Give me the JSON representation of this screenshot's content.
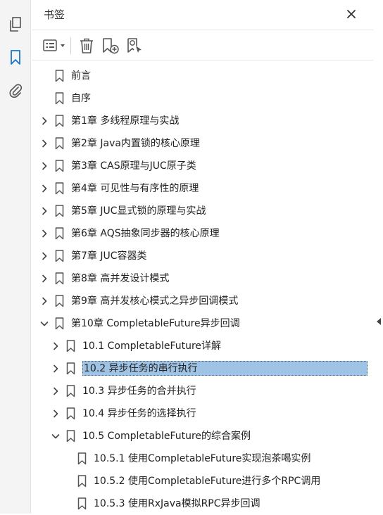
{
  "panel": {
    "title": "书签"
  },
  "rail": [
    {
      "name": "pages-icon"
    },
    {
      "name": "bookmark-icon",
      "active": true
    },
    {
      "name": "attachment-icon"
    }
  ],
  "toolbar": [
    {
      "name": "options-menu-icon"
    },
    {
      "name": "delete-bookmark-icon"
    },
    {
      "name": "new-bookmark-icon"
    },
    {
      "name": "find-bookmark-icon"
    }
  ],
  "colors": {
    "accent": "#1a73c8",
    "selection": "#9fc3e4",
    "icon": "#555555"
  },
  "bookmarks": [
    {
      "label": "前言",
      "level": 0,
      "toggle": "none"
    },
    {
      "label": "自序",
      "level": 0,
      "toggle": "none"
    },
    {
      "label": "第1章 多线程原理与实战",
      "level": 0,
      "toggle": "collapsed"
    },
    {
      "label": "第2章 Java内置锁的核心原理",
      "level": 0,
      "toggle": "collapsed"
    },
    {
      "label": "第3章 CAS原理与JUC原子类",
      "level": 0,
      "toggle": "collapsed"
    },
    {
      "label": "第4章 可见性与有序性的原理",
      "level": 0,
      "toggle": "collapsed"
    },
    {
      "label": "第5章 JUC显式锁的原理与实战",
      "level": 0,
      "toggle": "collapsed"
    },
    {
      "label": "第6章 AQS抽象同步器的核心原理",
      "level": 0,
      "toggle": "collapsed"
    },
    {
      "label": "第7章 JUC容器类",
      "level": 0,
      "toggle": "collapsed"
    },
    {
      "label": "第8章 高并发设计模式",
      "level": 0,
      "toggle": "collapsed"
    },
    {
      "label": "第9章 高并发核心模式之异步回调模式",
      "level": 0,
      "toggle": "collapsed"
    },
    {
      "label": "第10章 CompletableFuture异步回调",
      "level": 0,
      "toggle": "expanded"
    },
    {
      "label": "10.1 CompletableFuture详解",
      "level": 1,
      "toggle": "collapsed"
    },
    {
      "label": "10.2 异步任务的串行执行",
      "level": 1,
      "toggle": "collapsed",
      "selected": true
    },
    {
      "label": "10.3 异步任务的合并执行",
      "level": 1,
      "toggle": "collapsed"
    },
    {
      "label": "10.4 异步任务的选择执行",
      "level": 1,
      "toggle": "collapsed"
    },
    {
      "label": "10.5 CompletableFuture的综合案例",
      "level": 1,
      "toggle": "expanded"
    },
    {
      "label": "10.5.1 使用CompletableFuture实现泡茶喝实例",
      "level": 2,
      "toggle": "none"
    },
    {
      "label": "10.5.2 使用CompletableFuture进行多个RPC调用",
      "level": 2,
      "toggle": "none"
    },
    {
      "label": "10.5.3 使用RxJava模拟RPC异步回调",
      "level": 2,
      "toggle": "none"
    }
  ]
}
